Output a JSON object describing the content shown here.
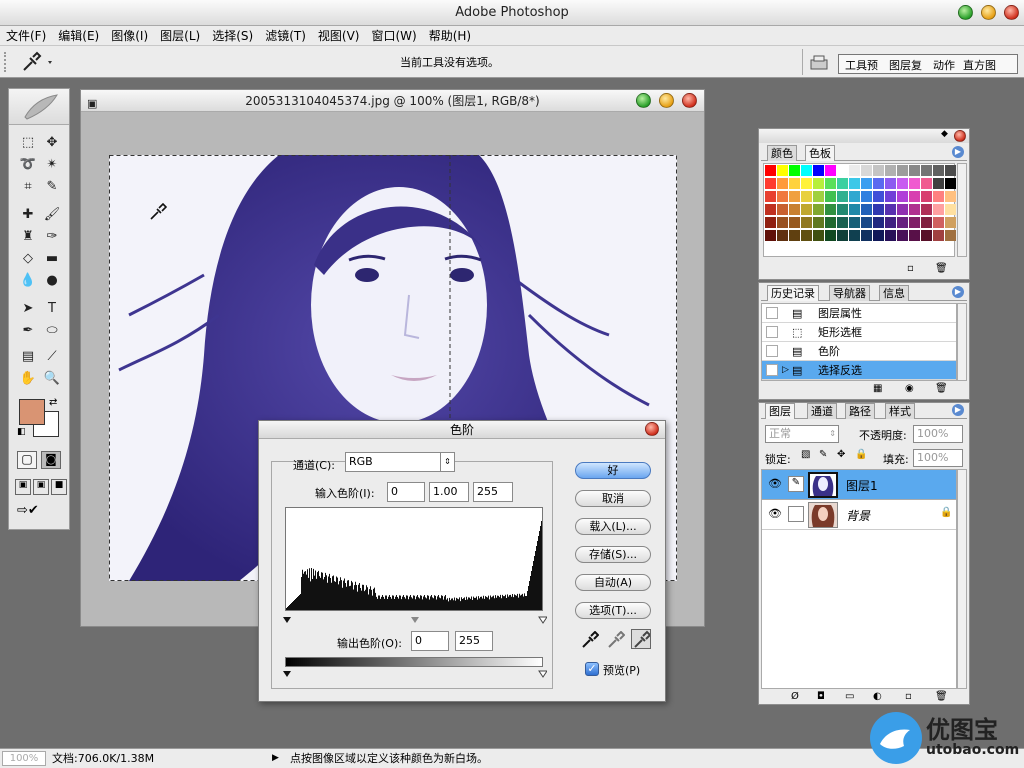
{
  "app": {
    "title": "Adobe Photoshop"
  },
  "menu": [
    "文件(F)",
    "编辑(E)",
    "图像(I)",
    "图层(L)",
    "选择(S)",
    "滤镜(T)",
    "视图(V)",
    "窗口(W)",
    "帮助(H)"
  ],
  "options_bar": {
    "message": "当前工具没有选项。",
    "palette_tabs": [
      "工具预",
      "图层复",
      "动作",
      "直方图"
    ]
  },
  "document": {
    "title": "2005313104045374.jpg @ 100% (图层1, RGB/8*)"
  },
  "swatch_panel": {
    "tabs": [
      "颜色",
      "色板"
    ]
  },
  "history_panel": {
    "tabs": [
      "历史记录",
      "导航器",
      "信息"
    ],
    "items": [
      "图层属性",
      "矩形选框",
      "色阶",
      "选择反选"
    ]
  },
  "layers_panel": {
    "tabs": [
      "图层",
      "通道",
      "路径",
      "样式"
    ],
    "blend_mode": "正常",
    "opacity_label": "不透明度:",
    "opacity_value": "100%",
    "lock_label": "锁定:",
    "fill_label": "填充:",
    "fill_value": "100%",
    "layers": [
      {
        "name": "图层1"
      },
      {
        "name": "背景"
      }
    ]
  },
  "levels_dialog": {
    "title": "色阶",
    "channel_label": "通道(C):",
    "channel_value": "RGB",
    "input_label": "输入色阶(I):",
    "input_values": [
      "0",
      "1.00",
      "255"
    ],
    "output_label": "输出色阶(O):",
    "output_values": [
      "0",
      "255"
    ],
    "buttons": {
      "ok": "好",
      "cancel": "取消",
      "load": "载入(L)...",
      "save": "存储(S)...",
      "auto": "自动(A)",
      "options": "选项(T)..."
    },
    "preview_label": "预览(P)",
    "preview_checked": true
  },
  "status": {
    "zoom": "100%",
    "doc_info": "文档:706.0K/1.38M",
    "hint": "点按图像区域以定义该种颜色为新白场。"
  },
  "watermark": {
    "brand": "优图宝",
    "url": "utobao.com"
  },
  "colors": {
    "foreground": "#d99473",
    "background": "#ffffff",
    "selection": "#5aa9ee",
    "hair": "#3f3590"
  }
}
